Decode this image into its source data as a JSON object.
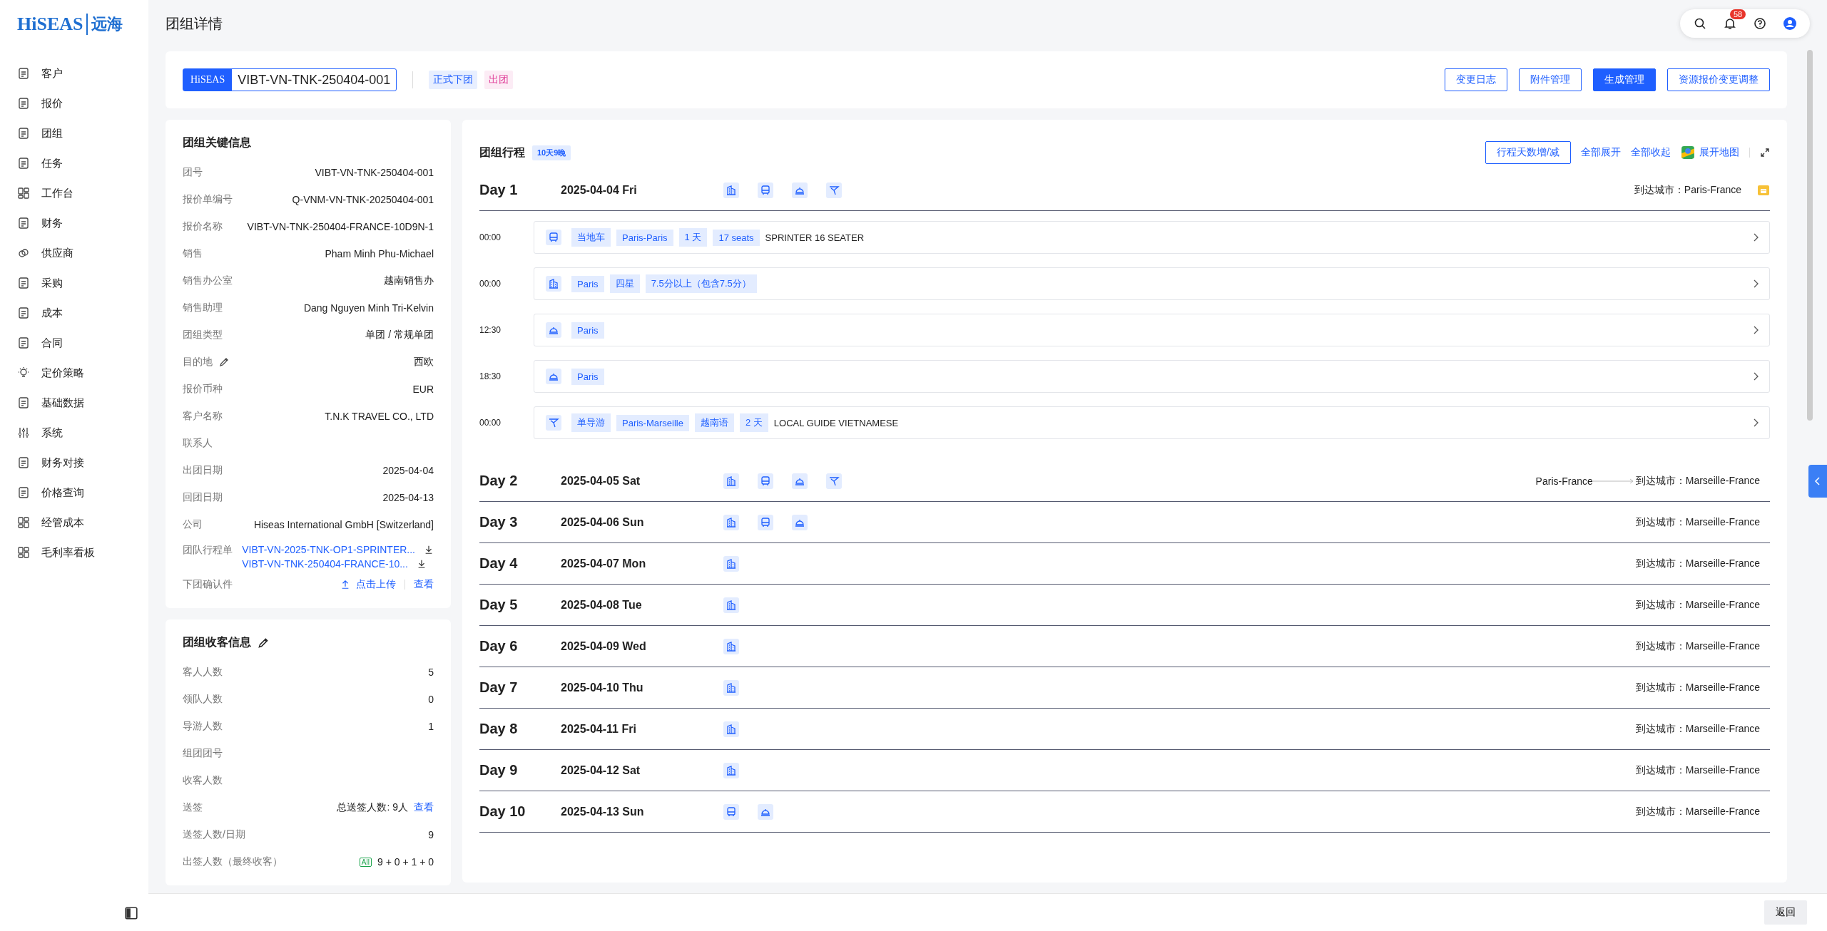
{
  "brand": {
    "logo": "HiSEAS",
    "logo_cn": "远海"
  },
  "sidebar": {
    "items": [
      {
        "label": "客户"
      },
      {
        "label": "报价"
      },
      {
        "label": "团组"
      },
      {
        "label": "任务"
      },
      {
        "label": "工作台"
      },
      {
        "label": "财务"
      },
      {
        "label": "供应商"
      },
      {
        "label": "采购"
      },
      {
        "label": "成本"
      },
      {
        "label": "合同"
      },
      {
        "label": "定价策略"
      },
      {
        "label": "基础数据"
      },
      {
        "label": "系统"
      },
      {
        "label": "财务对接"
      },
      {
        "label": "价格查询"
      },
      {
        "label": "经管成本"
      },
      {
        "label": "毛利率看板"
      }
    ]
  },
  "page_title": "团组详情",
  "topbar": {
    "notification_count": "58"
  },
  "header": {
    "logo_badge": "HiSEAS",
    "group_code": "VIBT-VN-TNK-250404-001",
    "tags": [
      {
        "label": "正式下团",
        "color": "#1f5fff"
      },
      {
        "label": "出团",
        "color": "#e0409a"
      }
    ],
    "buttons": [
      {
        "label": "变更日志",
        "kind": "outline"
      },
      {
        "label": "附件管理",
        "kind": "outline"
      },
      {
        "label": "生成管理",
        "kind": "primary"
      },
      {
        "label": "资源报价变更调整",
        "kind": "outline"
      }
    ]
  },
  "key_info": {
    "title": "团组关键信息",
    "rows": [
      {
        "label": "团号",
        "value": "VIBT-VN-TNK-250404-001",
        "editable": false
      },
      {
        "label": "报价单编号",
        "value": "Q-VNM-VN-TNK-20250404-001",
        "editable": false
      },
      {
        "label": "报价名称",
        "value": "VIBT-VN-TNK-250404-FRANCE-10D9N-1",
        "editable": false
      },
      {
        "label": "销售",
        "value": "Pham Minh Phu-Michael",
        "editable": false
      },
      {
        "label": "销售办公室",
        "value": "越南销售办",
        "editable": false
      },
      {
        "label": "销售助理",
        "value": "Dang Nguyen Minh Tri-Kelvin",
        "editable": false
      },
      {
        "label": "团组类型",
        "value": "单团 / 常规单团",
        "editable": false
      },
      {
        "label": "目的地",
        "value": "西欧",
        "editable": true
      },
      {
        "label": "报价币种",
        "value": "EUR",
        "editable": false
      },
      {
        "label": "客户名称",
        "value": "T.N.K TRAVEL CO., LTD",
        "editable": false
      },
      {
        "label": "联系人",
        "editable": false
      },
      {
        "label": "出团日期",
        "value": "2025-04-04",
        "editable": false
      },
      {
        "label": "回团日期",
        "value": "2025-04-13",
        "editable": false
      },
      {
        "label": "公司",
        "value": "Hiseas International GmbH [Switzerland]",
        "editable": false
      }
    ],
    "itinerary_files": {
      "label": "团队行程单",
      "files": [
        "VIBT-VN-2025-TNK-OP1-SPRINTER...",
        "VIBT-VN-TNK-250404-FRANCE-10..."
      ]
    },
    "confirmation": {
      "label": "下团确认件",
      "upload": "点击上传",
      "view": "查看"
    }
  },
  "guest_info": {
    "title": "团组收客信息",
    "rows": [
      {
        "label": "客人人数",
        "value": "5"
      },
      {
        "label": "领队人数",
        "value": "0"
      },
      {
        "label": "导游人数",
        "value": "1"
      },
      {
        "label": "组团团号"
      },
      {
        "label": "收客人数"
      },
      {
        "label": "送签",
        "value": "总送签人数: 9人",
        "link": "查看"
      },
      {
        "label": "送签人数/日期",
        "value": "9"
      },
      {
        "label": "出签人数（最终收客）",
        "badge": "All",
        "value": "9 + 0 + 1 + 0"
      }
    ]
  },
  "itinerary": {
    "title": "团组行程",
    "duration": "10天9晚",
    "adjust_button": "行程天数增/减",
    "expand_all": "全部展开",
    "collapse_all": "全部收起",
    "map": "展开地图",
    "days": [
      {
        "label": "Day 1",
        "date": "2025-04-04 Fri",
        "services": [
          {
            "kind": "hotel"
          },
          {
            "kind": "bus"
          },
          {
            "kind": "meal"
          },
          {
            "kind": "guide"
          }
        ],
        "arrival_label": "到达城市：",
        "arrival": "Paris-France",
        "expanded": true,
        "items": [
          {
            "time": "00:00",
            "kind": "bus",
            "tags": [
              "当地车",
              "Paris-Paris",
              "1 天",
              "17 seats"
            ],
            "description": "SPRINTER 16 SEATER"
          },
          {
            "time": "00:00",
            "kind": "hotel",
            "tags": [
              "Paris",
              "四星",
              "7.5分以上（包含7.5分）"
            ]
          },
          {
            "time": "12:30",
            "kind": "meal",
            "tags": [
              "Paris"
            ]
          },
          {
            "time": "18:30",
            "kind": "meal",
            "tags": [
              "Paris"
            ]
          },
          {
            "time": "00:00",
            "kind": "guide",
            "tags": [
              "单导游",
              "Paris-Marseille",
              "越南语",
              "2 天"
            ],
            "description": "LOCAL GUIDE VIETNAMESE"
          }
        ]
      },
      {
        "label": "Day 2",
        "date": "2025-04-05 Sat",
        "services": [
          {
            "kind": "hotel"
          },
          {
            "kind": "bus"
          },
          {
            "kind": "meal"
          },
          {
            "kind": "guide"
          }
        ],
        "from": "Paris-France",
        "arrival_label": "到达城市：",
        "arrival": "Marseille-France",
        "expanded": false
      },
      {
        "label": "Day 3",
        "date": "2025-04-06 Sun",
        "services": [
          {
            "kind": "hotel"
          },
          {
            "kind": "bus"
          },
          {
            "kind": "meal"
          }
        ],
        "arrival_label": "到达城市：",
        "arrival": "Marseille-France",
        "expanded": false
      },
      {
        "label": "Day 4",
        "date": "2025-04-07 Mon",
        "services": [
          {
            "kind": "hotel"
          }
        ],
        "arrival_label": "到达城市：",
        "arrival": "Marseille-France",
        "expanded": false
      },
      {
        "label": "Day 5",
        "date": "2025-04-08 Tue",
        "services": [
          {
            "kind": "hotel"
          }
        ],
        "arrival_label": "到达城市：",
        "arrival": "Marseille-France",
        "expanded": false
      },
      {
        "label": "Day 6",
        "date": "2025-04-09 Wed",
        "services": [
          {
            "kind": "hotel"
          }
        ],
        "arrival_label": "到达城市：",
        "arrival": "Marseille-France",
        "expanded": false
      },
      {
        "label": "Day 7",
        "date": "2025-04-10 Thu",
        "services": [
          {
            "kind": "hotel"
          }
        ],
        "arrival_label": "到达城市：",
        "arrival": "Marseille-France",
        "expanded": false
      },
      {
        "label": "Day 8",
        "date": "2025-04-11 Fri",
        "services": [
          {
            "kind": "hotel"
          }
        ],
        "arrival_label": "到达城市：",
        "arrival": "Marseille-France",
        "expanded": false
      },
      {
        "label": "Day 9",
        "date": "2025-04-12 Sat",
        "services": [
          {
            "kind": "hotel"
          }
        ],
        "arrival_label": "到达城市：",
        "arrival": "Marseille-France",
        "expanded": false
      },
      {
        "label": "Day 10",
        "date": "2025-04-13 Sun",
        "services": [
          {
            "kind": "bus"
          },
          {
            "kind": "meal"
          }
        ],
        "arrival_label": "到达城市：",
        "arrival": "Marseille-France",
        "expanded": false
      }
    ]
  },
  "footer": {
    "back_button": "返回"
  }
}
